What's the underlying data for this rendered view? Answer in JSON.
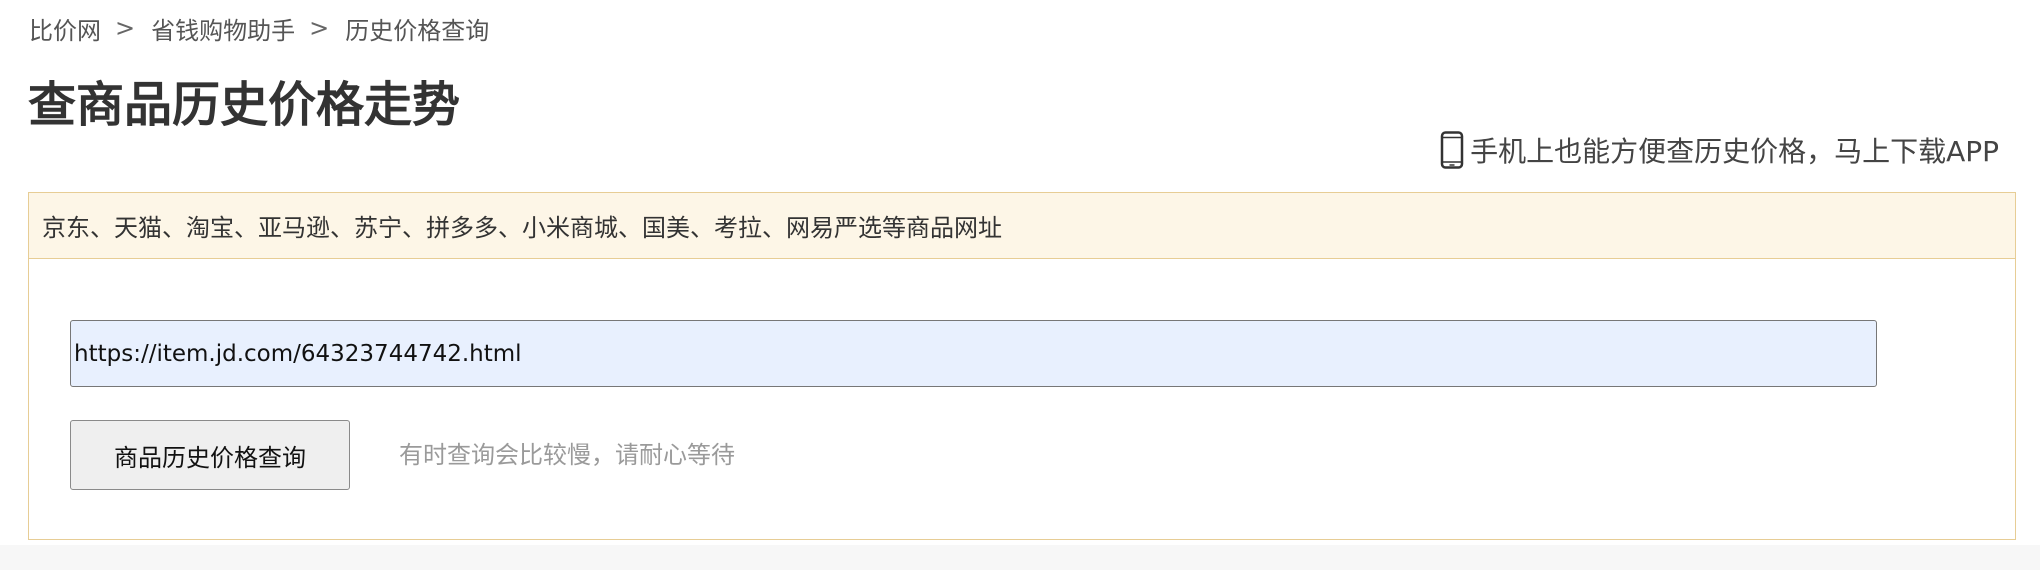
{
  "breadcrumb": {
    "items": [
      {
        "label": "比价网"
      },
      {
        "label": "省钱购物助手"
      },
      {
        "label": "历史价格查询"
      }
    ],
    "separator": ">"
  },
  "page_title": "查商品历史价格走势",
  "app_promo": {
    "icon": "phone-icon",
    "text": "手机上也能方便查历史价格，马上下载APP"
  },
  "panel": {
    "supported_sites": "京东、天猫、淘宝、亚马逊、苏宁、拼多多、小米商城、国美、考拉、网易严选等商品网址",
    "url_input": {
      "value": "https://item.jd.com/64323744742.html"
    },
    "query_button_label": "商品历史价格查询",
    "hint": "有时查询会比较慢，请耐心等待"
  },
  "colors": {
    "panel_border": "#e7cd95",
    "panel_header_bg": "#fdf6e7",
    "input_autofill_bg": "#e8f0fe",
    "hint_text": "#9a9a9a"
  }
}
